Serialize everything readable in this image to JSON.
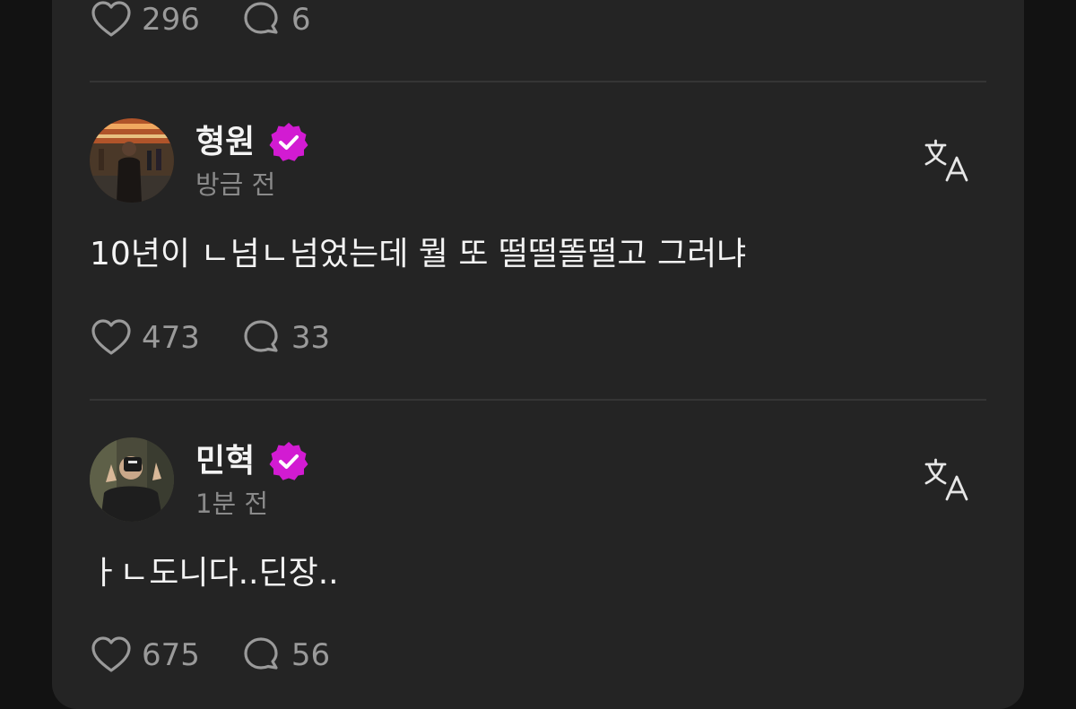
{
  "posts": [
    {
      "likes": "296",
      "comments": "6"
    },
    {
      "username": "형원",
      "verified": true,
      "time": "방금 전",
      "text": "10년이 ㄴ넘ㄴ넘었는데 뭘 또 떨떨똘떨고 그러냐",
      "likes": "473",
      "comments": "33"
    },
    {
      "username": "민혁",
      "verified": true,
      "time": "1분 전",
      "text": "ㅏㄴ도니다..딘장..",
      "likes": "675",
      "comments": "56"
    }
  ],
  "icons": {
    "like": "heart-icon",
    "comment": "comment-bubble-icon",
    "translate": "translate-icon",
    "verified": "verified-badge-icon"
  },
  "colors": {
    "background": "#121212",
    "card": "#242424",
    "verified": "#d21bd2",
    "text": "#f3f3f3",
    "muted": "#8a8a8a"
  }
}
